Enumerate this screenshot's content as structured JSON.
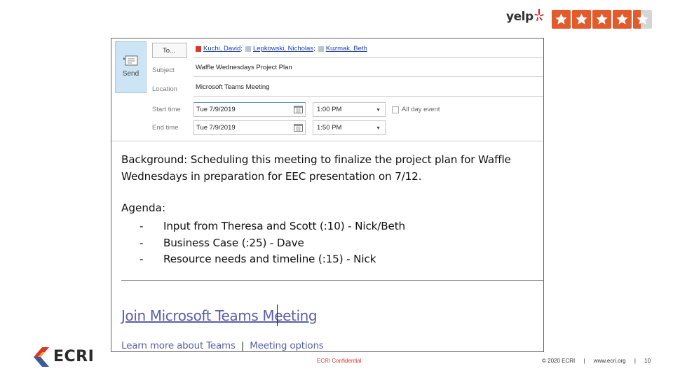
{
  "yelp": {
    "wordmark": "yelp",
    "rating_stars": 4.4,
    "star_color": "#e35a2b"
  },
  "window": {
    "send_label": "Send",
    "to_button": "To...",
    "recipients": [
      {
        "name": "Kuchi, David",
        "sep": ";",
        "chip": "red"
      },
      {
        "name": "Lepkowski, Nicholas",
        "sep": ";",
        "chip": "gray"
      },
      {
        "name": "Kuzmak, Beth",
        "sep": "",
        "chip": "gray"
      }
    ],
    "subject_label": "Subject",
    "subject_value": "Waffle Wednesdays Project Plan",
    "location_label": "Location",
    "location_value": "Microsoft Teams Meeting",
    "start_label": "Start time",
    "start_date": "Tue 7/9/2019",
    "start_time": "1:00 PM",
    "all_day_label": "All day event",
    "end_label": "End time",
    "end_date": "Tue 7/9/2019",
    "end_time": "1:50 PM"
  },
  "body": {
    "background": "Background: Scheduling this meeting to finalize the project plan for Waffle Wednesdays in preparation for EEC presentation on 7/12.",
    "agenda_title": "Agenda:",
    "agenda_items": [
      {
        "dash": "-",
        "text": "Input from Theresa and Scott (:10) - Nick/Beth"
      },
      {
        "dash": "-",
        "text": "Business Case (:25) - Dave"
      },
      {
        "dash": "-",
        "text": "Resource needs and timeline (:15) - Nick"
      }
    ],
    "teams_link": "Join Microsoft Teams Meeting",
    "learn_more": "Learn more about Teams",
    "pipe": "|",
    "meeting_options": "Meeting options"
  },
  "footer": {
    "logo_text": "ECRI",
    "confidential": "ECRI Confidential",
    "copyright": "© 2020 ECRI",
    "divider": "|",
    "website": "www.ecri.org",
    "page_number": "10"
  }
}
